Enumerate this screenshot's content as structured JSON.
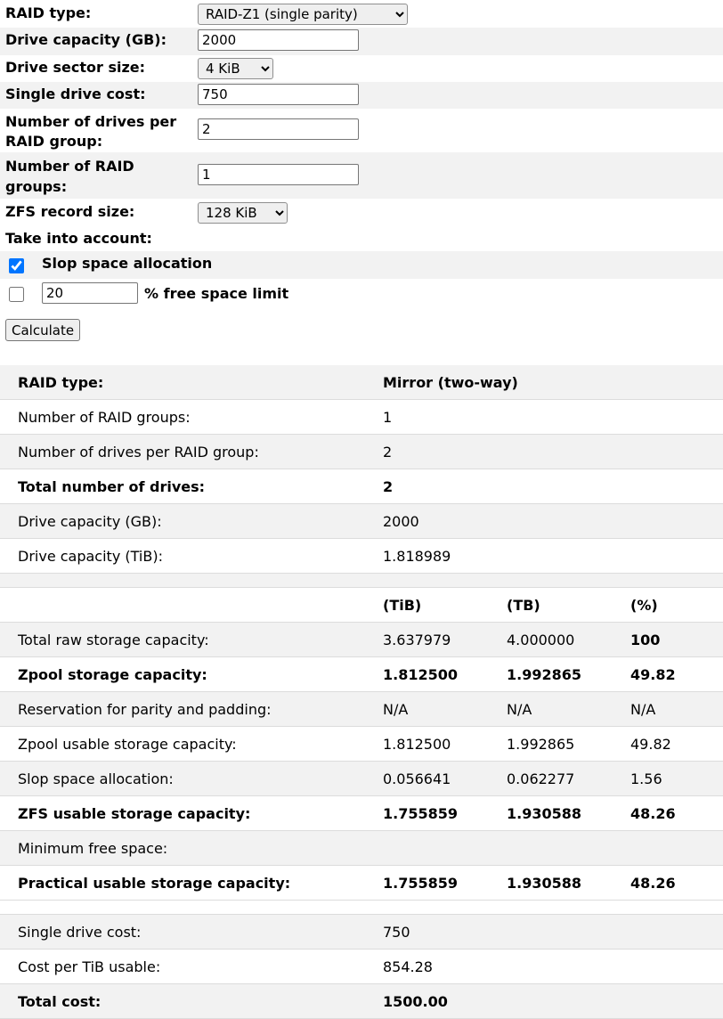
{
  "form": {
    "raid_type": {
      "label": "RAID type:",
      "value": "RAID-Z1 (single parity)"
    },
    "drive_capacity": {
      "label": "Drive capacity (GB):",
      "value": "2000"
    },
    "sector_size": {
      "label": "Drive sector size:",
      "value": "4 KiB"
    },
    "drive_cost": {
      "label": "Single drive cost:",
      "value": "750"
    },
    "drives_per_group": {
      "label_line1": "Number of drives per",
      "label_line2": "RAID group:",
      "value": "2"
    },
    "raid_groups": {
      "label_line1": "Number of RAID",
      "label_line2": "groups:",
      "value": "1"
    },
    "record_size": {
      "label": "ZFS record size:",
      "value": "128 KiB"
    },
    "take_into_account": "Take into account:",
    "slop": {
      "label": "Slop space allocation",
      "checked": true
    },
    "free_limit": {
      "label": "% free space limit",
      "value": "20",
      "checked": false
    },
    "calculate_label": "Calculate"
  },
  "results": {
    "info": [
      {
        "label": "RAID type:",
        "value": "Mirror (two-way)",
        "bold": true
      },
      {
        "label": "Number of RAID groups:",
        "value": "1"
      },
      {
        "label": "Number of drives per RAID group:",
        "value": "2"
      },
      {
        "label": "Total number of drives:",
        "value": "2",
        "bold": true
      },
      {
        "label": "Drive capacity (GB):",
        "value": "2000"
      },
      {
        "label": "Drive capacity (TiB):",
        "value": "1.818989"
      }
    ],
    "capacity_headers": [
      "(TiB)",
      "(TB)",
      "(%)"
    ],
    "capacity": [
      {
        "label": "Total raw storage capacity:",
        "tib": "3.637979",
        "tb": "4.000000",
        "pct": "100"
      },
      {
        "label": "Zpool storage capacity:",
        "tib": "1.812500",
        "tb": "1.992865",
        "pct": "49.82",
        "bold": true
      },
      {
        "label": "Reservation for parity and padding:",
        "tib": "N/A",
        "tb": "N/A",
        "pct": "N/A"
      },
      {
        "label": "Zpool usable storage capacity:",
        "tib": "1.812500",
        "tb": "1.992865",
        "pct": "49.82"
      },
      {
        "label": "Slop space allocation:",
        "tib": "0.056641",
        "tb": "0.062277",
        "pct": "1.56"
      },
      {
        "label": "ZFS usable storage capacity:",
        "tib": "1.755859",
        "tb": "1.930588",
        "pct": "48.26",
        "bold": true
      },
      {
        "label": "Minimum free space:",
        "tib": "",
        "tb": "",
        "pct": ""
      },
      {
        "label": "Practical usable storage capacity:",
        "tib": "1.755859",
        "tb": "1.930588",
        "pct": "48.26",
        "bold": true
      }
    ],
    "cost": [
      {
        "label": "Single drive cost:",
        "value": "750"
      },
      {
        "label": "Cost per TiB usable:",
        "value": "854.28"
      },
      {
        "label": "Total cost:",
        "value": "1500.00",
        "bold": true
      }
    ]
  }
}
